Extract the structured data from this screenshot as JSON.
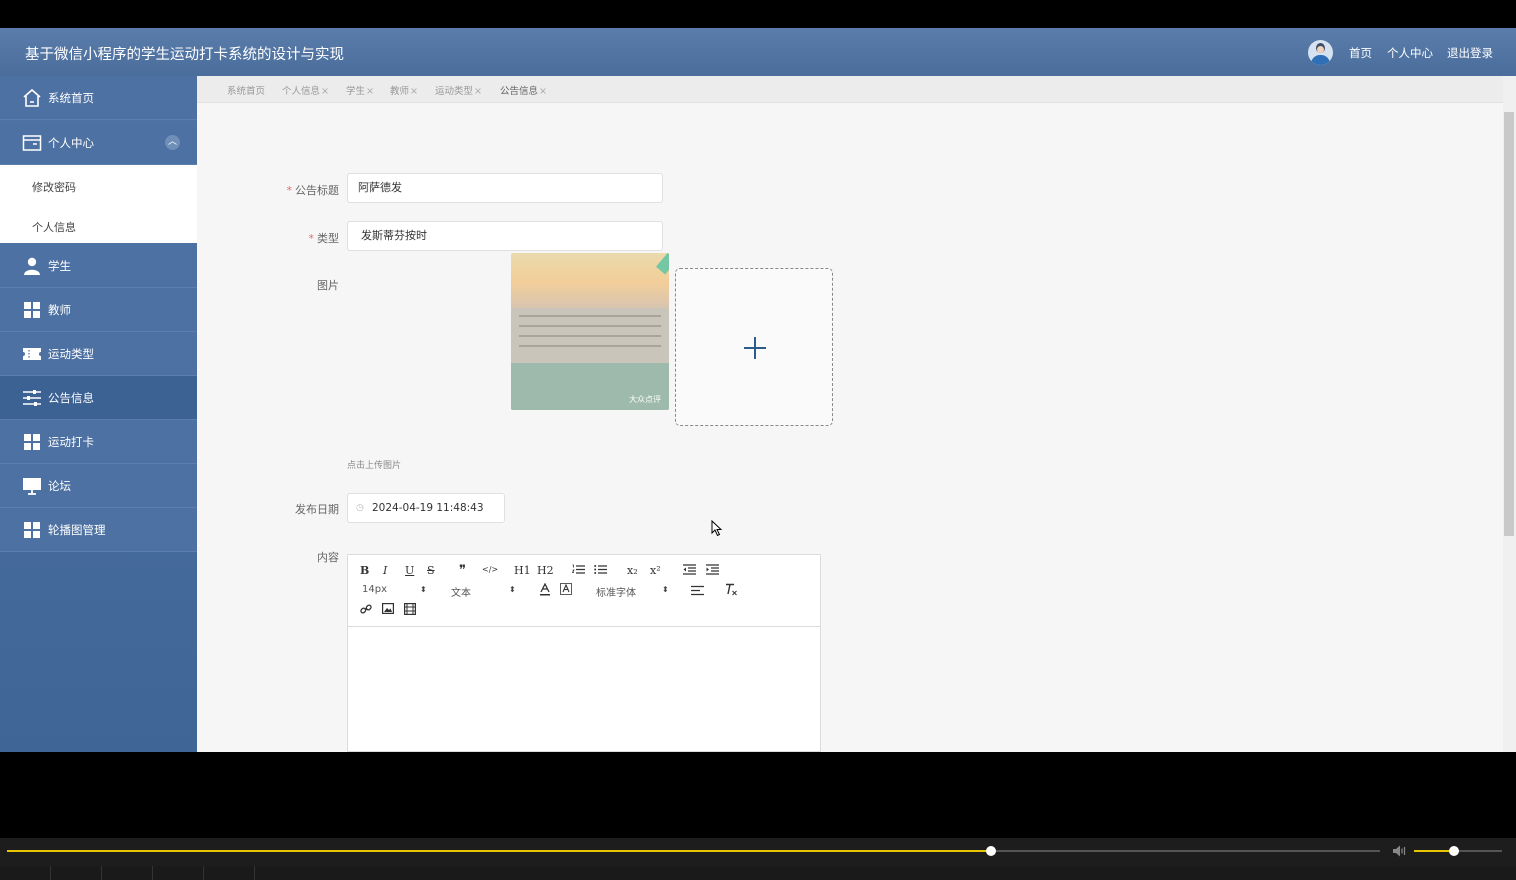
{
  "app": {
    "title": "基于微信小程序的学生运动打卡系统的设计与实现",
    "top_links": [
      "首页",
      "个人中心",
      "退出登录"
    ]
  },
  "sidebar": {
    "items": [
      {
        "label": "系统首页",
        "icon": "home-icon"
      },
      {
        "label": "个人中心",
        "icon": "wallet-card-icon",
        "expanded": true
      },
      {
        "label": "学生",
        "icon": "user-icon"
      },
      {
        "label": "教师",
        "icon": "grid-icon"
      },
      {
        "label": "运动类型",
        "icon": "ticket-icon"
      },
      {
        "label": "公告信息",
        "icon": "sliders-icon",
        "active": true
      },
      {
        "label": "运动打卡",
        "icon": "grid-icon"
      },
      {
        "label": "论坛",
        "icon": "monitor-icon"
      },
      {
        "label": "轮播图管理",
        "icon": "grid-icon"
      }
    ],
    "submenu": [
      "修改密码",
      "个人信息"
    ]
  },
  "tabs": [
    {
      "label": "系统首页",
      "close": ""
    },
    {
      "label": "个人信息",
      "close": "×"
    },
    {
      "label": "学生",
      "close": "×"
    },
    {
      "label": "教师",
      "close": "×"
    },
    {
      "label": "运动类型",
      "close": "×"
    },
    {
      "label": "公告信息",
      "close": "×"
    }
  ],
  "form": {
    "required_mark": "*",
    "title_label": "公告标题",
    "title_value": "阿萨德发",
    "type_label": "类型",
    "type_value": "发斯蒂芬按时",
    "image_label": "图片",
    "image_watermark": "大众点评",
    "upload_hint": "点击上传图片",
    "date_label": "发布日期",
    "date_value": "2024-04-19 11:48:43",
    "content_label": "内容"
  },
  "editor": {
    "buttons": [
      "B",
      "I",
      "U",
      "S",
      "❞",
      "</>",
      "H1",
      "H2",
      "ol",
      "ul",
      "x₂",
      "x²",
      "outdent",
      "indent"
    ],
    "font_size": "14px",
    "header_select": "文本",
    "font_family": "标准字体"
  },
  "player": {
    "progress": 0.717,
    "volume": 0.45
  },
  "colors": {
    "header": "#4a6d9c",
    "sidebar": "#4d71a2",
    "sidebar_active": "#3c6294",
    "progress": "#e8c400"
  }
}
